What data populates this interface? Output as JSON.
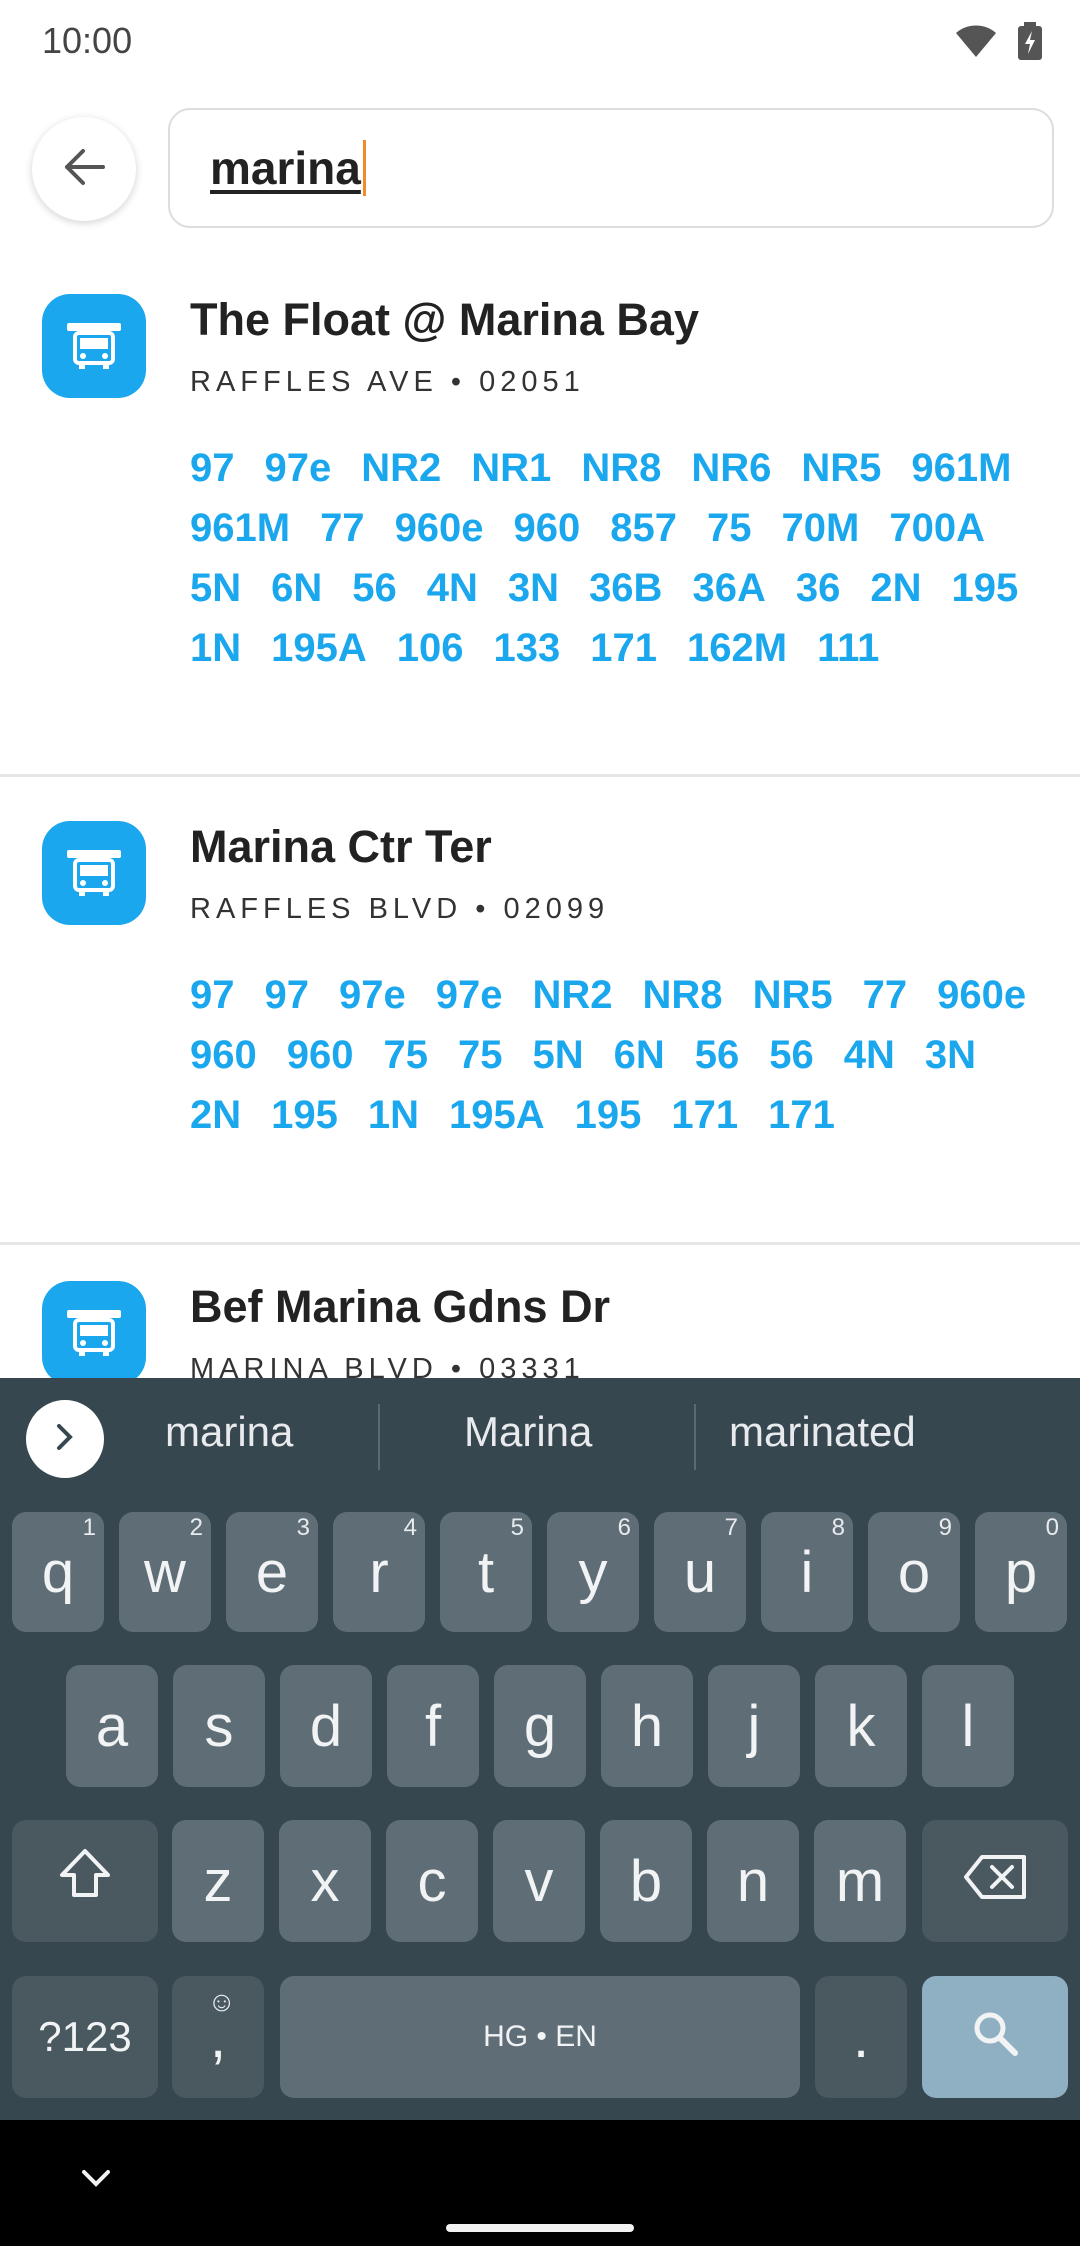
{
  "status_bar": {
    "time": "10:00",
    "wifi_icon": "wifi-icon",
    "battery_icon": "battery-charging-icon"
  },
  "search": {
    "query": "marina"
  },
  "results": [
    {
      "name": "The Float @ Marina Bay",
      "subtitle": "RAFFLES AVE • 02051",
      "routes": [
        "97",
        "97e",
        "NR2",
        "NR1",
        "NR8",
        "NR6",
        "NR5",
        "961M",
        "961M",
        "77",
        "960e",
        "960",
        "857",
        "75",
        "70M",
        "700A",
        "5N",
        "6N",
        "56",
        "4N",
        "3N",
        "36B",
        "36A",
        "36",
        "2N",
        "195",
        "1N",
        "195A",
        "106",
        "133",
        "171",
        "162M",
        "111"
      ]
    },
    {
      "name": "Marina Ctr Ter",
      "subtitle": "RAFFLES BLVD • 02099",
      "routes": [
        "97",
        "97",
        "97e",
        "97e",
        "NR2",
        "NR8",
        "NR5",
        "77",
        "960e",
        "960",
        "960",
        "75",
        "75",
        "5N",
        "6N",
        "56",
        "56",
        "4N",
        "3N",
        "2N",
        "195",
        "1N",
        "195A",
        "195",
        "171",
        "171"
      ]
    },
    {
      "name": "Bef Marina Gdns Dr",
      "subtitle": "MARINA BLVD • 03331",
      "routes": []
    }
  ],
  "keyboard": {
    "suggestions": [
      "marina",
      "Marina",
      "marinated"
    ],
    "row1": [
      {
        "k": "q",
        "h": "1"
      },
      {
        "k": "w",
        "h": "2"
      },
      {
        "k": "e",
        "h": "3"
      },
      {
        "k": "r",
        "h": "4"
      },
      {
        "k": "t",
        "h": "5"
      },
      {
        "k": "y",
        "h": "6"
      },
      {
        "k": "u",
        "h": "7"
      },
      {
        "k": "i",
        "h": "8"
      },
      {
        "k": "o",
        "h": "9"
      },
      {
        "k": "p",
        "h": "0"
      }
    ],
    "row2": [
      "a",
      "s",
      "d",
      "f",
      "g",
      "h",
      "j",
      "k",
      "l"
    ],
    "row3": [
      "z",
      "x",
      "c",
      "v",
      "b",
      "n",
      "m"
    ],
    "symbols_label": "?123",
    "comma_label": ",",
    "emoji_hint": "☺",
    "space_label": "HG • EN",
    "period_label": "."
  }
}
